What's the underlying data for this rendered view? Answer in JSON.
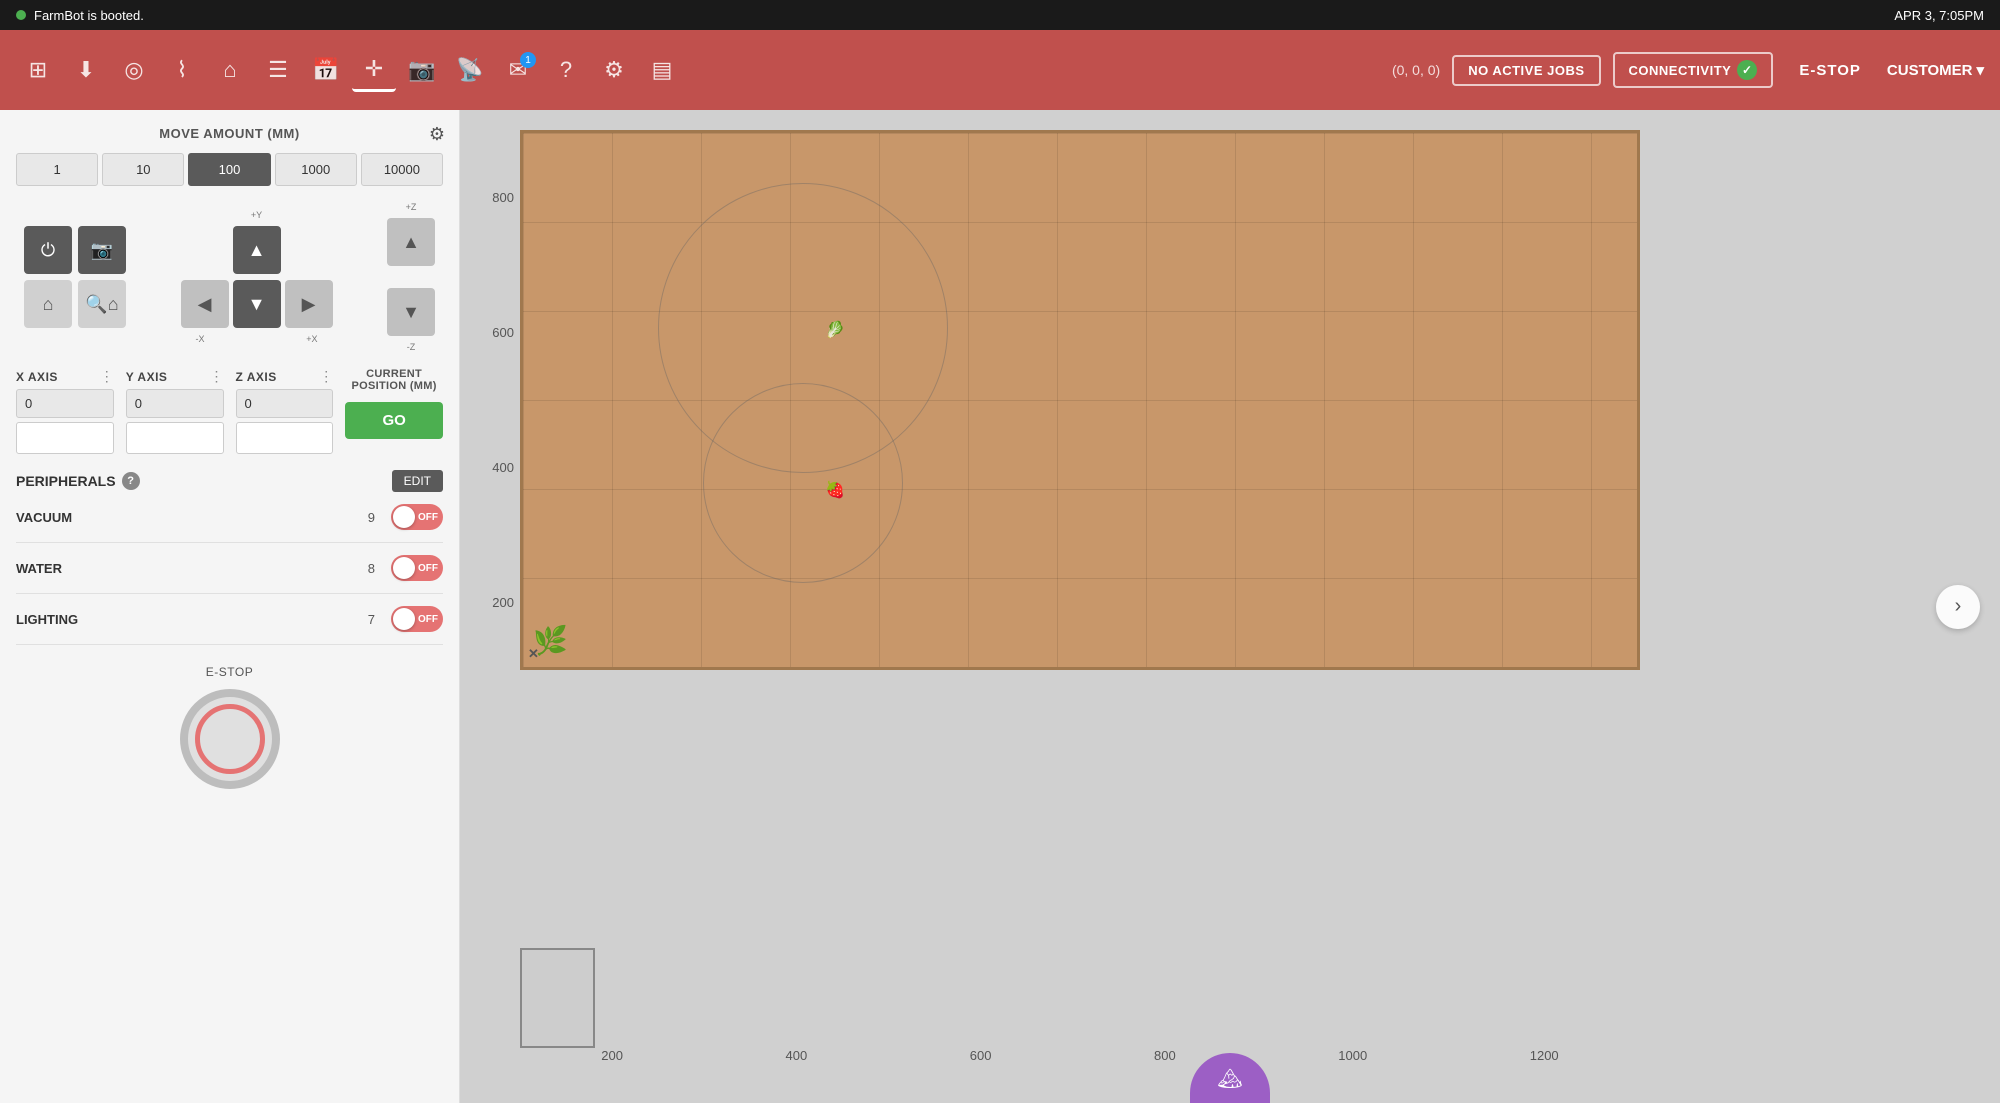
{
  "system_bar": {
    "status": "FarmBot is booted.",
    "datetime": "APR 3, 7:05PM"
  },
  "nav": {
    "icons": [
      {
        "name": "plants-icon",
        "symbol": "⊞",
        "active": false
      },
      {
        "name": "download-icon",
        "symbol": "⬇",
        "active": false
      },
      {
        "name": "regimens-icon",
        "symbol": "◎",
        "active": false
      },
      {
        "name": "tools-icon",
        "symbol": "⌇",
        "active": false
      },
      {
        "name": "scenarios-icon",
        "symbol": "⌂",
        "active": false
      },
      {
        "name": "sequences-icon",
        "symbol": "☰",
        "active": false
      },
      {
        "name": "calendar-icon",
        "symbol": "⊟",
        "active": false
      },
      {
        "name": "controls-icon",
        "symbol": "✛",
        "active": true
      },
      {
        "name": "camera-icon",
        "symbol": "⬡",
        "active": false
      },
      {
        "name": "sensors-icon",
        "symbol": "⌤",
        "active": false
      },
      {
        "name": "messages-icon",
        "symbol": "✉",
        "active": false,
        "badge": "1"
      },
      {
        "name": "help-icon",
        "symbol": "?",
        "active": false
      },
      {
        "name": "settings-icon",
        "symbol": "⚙",
        "active": false
      },
      {
        "name": "logs-icon",
        "symbol": "▤",
        "active": false
      }
    ],
    "coords": "(0, 0, 0)",
    "no_active_jobs": "NO ACTIVE JOBS",
    "connectivity": "CONNECTIVITY",
    "estop": "E-STOP",
    "customer": "CUSTOMER"
  },
  "controls": {
    "move_amount_title": "MOVE AMOUNT (MM)",
    "amounts": [
      "1",
      "10",
      "100",
      "1000",
      "10000"
    ],
    "active_amount": "100",
    "axes": [
      {
        "label": "X AXIS",
        "value": "0"
      },
      {
        "label": "Y AXIS",
        "value": "0"
      },
      {
        "label": "Z AXIS",
        "value": "0"
      }
    ],
    "current_position_title": "CURRENT\nPOSITION (MM)",
    "go_label": "GO"
  },
  "peripherals": {
    "title": "PERIPHERALS",
    "edit_label": "EDIT",
    "items": [
      {
        "name": "VACUUM",
        "pin": "9",
        "state": "OFF"
      },
      {
        "name": "WATER",
        "pin": "8",
        "state": "OFF"
      },
      {
        "name": "LIGHTING",
        "pin": "7",
        "state": "OFF"
      }
    ]
  },
  "estop_section": {
    "label": "E-STOP"
  },
  "map": {
    "x_labels": [
      "200",
      "400",
      "600",
      "800",
      "1000",
      "1200"
    ],
    "y_labels": [
      "800",
      "600",
      "400",
      "200"
    ]
  }
}
